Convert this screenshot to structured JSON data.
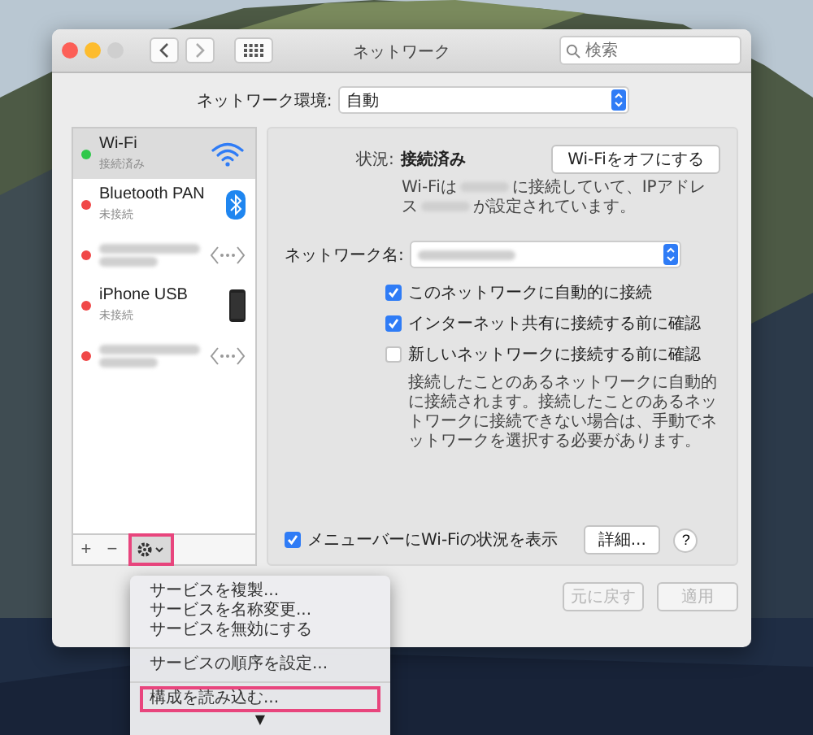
{
  "window": {
    "title": "ネットワーク",
    "search": {
      "placeholder": "検索"
    }
  },
  "location": {
    "label": "ネットワーク環境:",
    "value": "自動"
  },
  "services": [
    {
      "name": "Wi-Fi",
      "status": "接続済み",
      "color": "#2fc84a",
      "kind": "wifi",
      "selected": true
    },
    {
      "name": "Bluetooth PAN",
      "status": "未接続",
      "color": "#f04848",
      "kind": "bluetooth",
      "selected": false
    },
    {
      "color": "#f04848",
      "kind": "ethernet",
      "selected": false
    },
    {
      "name": "iPhone USB",
      "status": "未接続",
      "color": "#f04848",
      "kind": "phone",
      "selected": false
    },
    {
      "color": "#f04848",
      "kind": "ethernet",
      "selected": false
    }
  ],
  "sidebar_buttons": [
    {
      "label": "+"
    },
    {
      "label": "−"
    }
  ],
  "gear_highlighted": true,
  "detail": {
    "status_label": "状況:",
    "status_value": "接続済み",
    "toggle_button": "Wi-Fiをオフにする",
    "description": [
      "Wi-Fiは",
      "に接続していて、IPアドレス",
      "が設定されています。"
    ],
    "network_name_label": "ネットワーク名:",
    "options": [
      {
        "label": "このネットワークに自動的に接続",
        "checked": true
      },
      {
        "label": "インターネット共有に接続する前に確認",
        "checked": true
      },
      {
        "label": "新しいネットワークに接続する前に確認",
        "checked": false
      }
    ],
    "note": "接続したことのあるネットワークに自動的に接続されます。接続したことのあるネットワークに接続できない場合は、手動でネットワークを選択する必要があります。",
    "menubar_option": {
      "label": "メニューバーにWi-Fiの状況を表示",
      "checked": true
    },
    "advanced_button": "詳細...",
    "help_button": "?"
  },
  "footer_buttons": [
    {
      "label": "元に戻す",
      "disabled": true
    },
    {
      "label": "適用",
      "disabled": true
    }
  ],
  "action_menu": {
    "groups": [
      [
        {
          "label": "サービスを複製...",
          "highlighted": false
        },
        {
          "label": "サービスを名称変更...",
          "highlighted": false
        },
        {
          "label": "サービスを無効にする",
          "highlighted": false
        }
      ],
      [
        {
          "label": "サービスの順序を設定...",
          "highlighted": false
        }
      ],
      [
        {
          "label": "構成を読み込む...",
          "highlighted": true
        }
      ]
    ],
    "more_arrow": "▼"
  }
}
